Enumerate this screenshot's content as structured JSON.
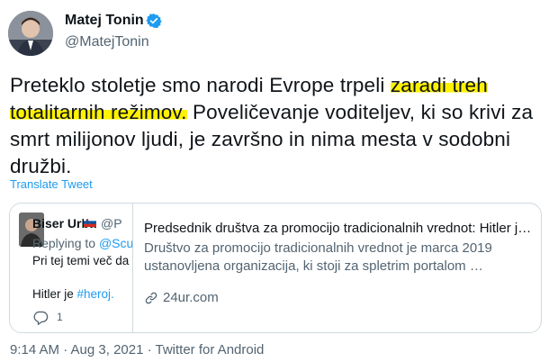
{
  "tweet": {
    "author_name": "Matej Tonin",
    "author_handle": "@MatejTonin",
    "text_before": "Preteklo stoletje smo narodi Evrope trpeli ",
    "text_highlight": "zaradi treh totalitarnih režimov.",
    "text_after": " Poveličevanje voditeljev, ki so krivi za smrt milijonov ljudi, je završno in nima mesta v sodobni družbi.",
    "translate_label": "Translate Tweet",
    "timestamp": "9:14 AM · Aug 3, 2021 · Twitter for Android",
    "highlight_color": "#fff200"
  },
  "quoted": {
    "author_name": "Biser Urba",
    "author_handle": "@P",
    "replying_prefix": "Replying to ",
    "replying_mention": "@Scut",
    "line1": "Pri tej temi več da",
    "line2_prefix": "Hitler je ",
    "line2_tag": "#heroj.",
    "reply_count": "1"
  },
  "card": {
    "title": "Predsednik društva za promocijo tradicionalnih vrednot: Hitler je …",
    "description": "Društvo za promocijo tradicionalnih vrednot je marca 2019 ustanovljena organizacija, ki stoji za spletrim portalom …",
    "domain": "24ur.com"
  },
  "icons": {
    "verified": "verified-badge-icon",
    "flag": "slovenia-flag-icon",
    "reply": "reply-icon",
    "link": "link-icon"
  },
  "colors": {
    "link": "#1d9bf0",
    "secondary": "#536471",
    "border": "#cfd9de"
  }
}
